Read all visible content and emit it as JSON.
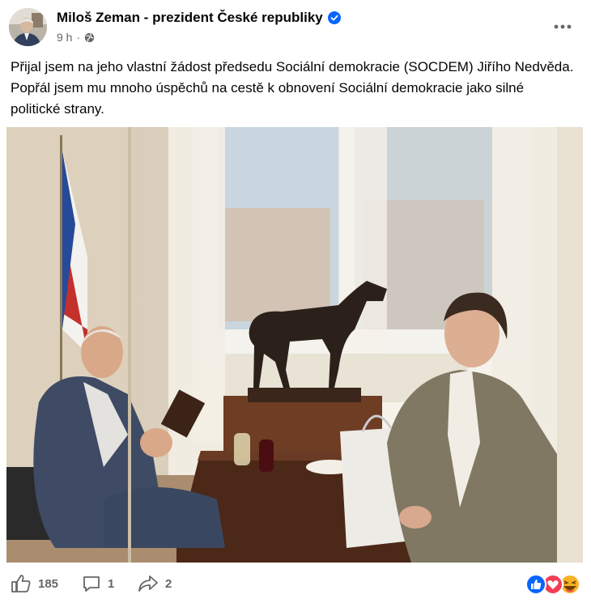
{
  "post": {
    "author": "Miloš Zeman - prezident České republiky",
    "verified_icon": "verified-badge-icon",
    "time": "9 h",
    "audience_icon": "globe-icon",
    "more_icon": "more-options-icon",
    "text": "Přijal jsem na jeho vlastní žádost předsedu Sociální demokracie (SOCDEM) Jiřího Nedvěda. Popřál jsem mu mnoho úspěchů na cestě k obnovení Sociální demokracie jako silné politické strany."
  },
  "footer": {
    "likes": "185",
    "comments": "1",
    "shares": "2",
    "like_icon": "thumbs-up-icon",
    "comment_icon": "comment-icon",
    "share_icon": "share-icon",
    "reaction_icons": [
      "like-reaction-icon",
      "love-reaction-icon",
      "haha-reaction-icon"
    ]
  },
  "colors": {
    "brand_blue": "#0866ff",
    "love_red": "#f33e58",
    "haha_yellow": "#f7b125",
    "text_secondary": "#65676b"
  }
}
